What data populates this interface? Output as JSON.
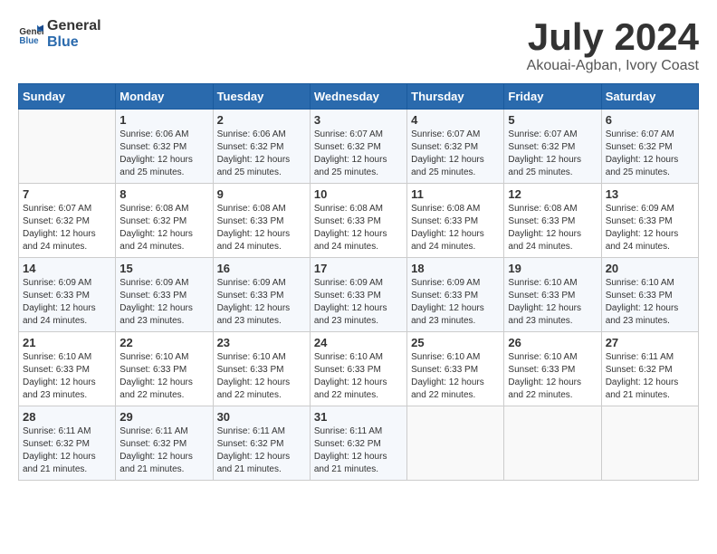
{
  "header": {
    "logo_general": "General",
    "logo_blue": "Blue",
    "month_year": "July 2024",
    "location": "Akouai-Agban, Ivory Coast"
  },
  "calendar": {
    "weekdays": [
      "Sunday",
      "Monday",
      "Tuesday",
      "Wednesday",
      "Thursday",
      "Friday",
      "Saturday"
    ],
    "weeks": [
      [
        {
          "day": "",
          "sunrise": "",
          "sunset": "",
          "daylight": "",
          "empty": true
        },
        {
          "day": "1",
          "sunrise": "Sunrise: 6:06 AM",
          "sunset": "Sunset: 6:32 PM",
          "daylight": "Daylight: 12 hours and 25 minutes."
        },
        {
          "day": "2",
          "sunrise": "Sunrise: 6:06 AM",
          "sunset": "Sunset: 6:32 PM",
          "daylight": "Daylight: 12 hours and 25 minutes."
        },
        {
          "day": "3",
          "sunrise": "Sunrise: 6:07 AM",
          "sunset": "Sunset: 6:32 PM",
          "daylight": "Daylight: 12 hours and 25 minutes."
        },
        {
          "day": "4",
          "sunrise": "Sunrise: 6:07 AM",
          "sunset": "Sunset: 6:32 PM",
          "daylight": "Daylight: 12 hours and 25 minutes."
        },
        {
          "day": "5",
          "sunrise": "Sunrise: 6:07 AM",
          "sunset": "Sunset: 6:32 PM",
          "daylight": "Daylight: 12 hours and 25 minutes."
        },
        {
          "day": "6",
          "sunrise": "Sunrise: 6:07 AM",
          "sunset": "Sunset: 6:32 PM",
          "daylight": "Daylight: 12 hours and 25 minutes."
        }
      ],
      [
        {
          "day": "7",
          "sunrise": "Sunrise: 6:07 AM",
          "sunset": "Sunset: 6:32 PM",
          "daylight": "Daylight: 12 hours and 24 minutes."
        },
        {
          "day": "8",
          "sunrise": "Sunrise: 6:08 AM",
          "sunset": "Sunset: 6:32 PM",
          "daylight": "Daylight: 12 hours and 24 minutes."
        },
        {
          "day": "9",
          "sunrise": "Sunrise: 6:08 AM",
          "sunset": "Sunset: 6:33 PM",
          "daylight": "Daylight: 12 hours and 24 minutes."
        },
        {
          "day": "10",
          "sunrise": "Sunrise: 6:08 AM",
          "sunset": "Sunset: 6:33 PM",
          "daylight": "Daylight: 12 hours and 24 minutes."
        },
        {
          "day": "11",
          "sunrise": "Sunrise: 6:08 AM",
          "sunset": "Sunset: 6:33 PM",
          "daylight": "Daylight: 12 hours and 24 minutes."
        },
        {
          "day": "12",
          "sunrise": "Sunrise: 6:08 AM",
          "sunset": "Sunset: 6:33 PM",
          "daylight": "Daylight: 12 hours and 24 minutes."
        },
        {
          "day": "13",
          "sunrise": "Sunrise: 6:09 AM",
          "sunset": "Sunset: 6:33 PM",
          "daylight": "Daylight: 12 hours and 24 minutes."
        }
      ],
      [
        {
          "day": "14",
          "sunrise": "Sunrise: 6:09 AM",
          "sunset": "Sunset: 6:33 PM",
          "daylight": "Daylight: 12 hours and 24 minutes."
        },
        {
          "day": "15",
          "sunrise": "Sunrise: 6:09 AM",
          "sunset": "Sunset: 6:33 PM",
          "daylight": "Daylight: 12 hours and 23 minutes."
        },
        {
          "day": "16",
          "sunrise": "Sunrise: 6:09 AM",
          "sunset": "Sunset: 6:33 PM",
          "daylight": "Daylight: 12 hours and 23 minutes."
        },
        {
          "day": "17",
          "sunrise": "Sunrise: 6:09 AM",
          "sunset": "Sunset: 6:33 PM",
          "daylight": "Daylight: 12 hours and 23 minutes."
        },
        {
          "day": "18",
          "sunrise": "Sunrise: 6:09 AM",
          "sunset": "Sunset: 6:33 PM",
          "daylight": "Daylight: 12 hours and 23 minutes."
        },
        {
          "day": "19",
          "sunrise": "Sunrise: 6:10 AM",
          "sunset": "Sunset: 6:33 PM",
          "daylight": "Daylight: 12 hours and 23 minutes."
        },
        {
          "day": "20",
          "sunrise": "Sunrise: 6:10 AM",
          "sunset": "Sunset: 6:33 PM",
          "daylight": "Daylight: 12 hours and 23 minutes."
        }
      ],
      [
        {
          "day": "21",
          "sunrise": "Sunrise: 6:10 AM",
          "sunset": "Sunset: 6:33 PM",
          "daylight": "Daylight: 12 hours and 23 minutes."
        },
        {
          "day": "22",
          "sunrise": "Sunrise: 6:10 AM",
          "sunset": "Sunset: 6:33 PM",
          "daylight": "Daylight: 12 hours and 22 minutes."
        },
        {
          "day": "23",
          "sunrise": "Sunrise: 6:10 AM",
          "sunset": "Sunset: 6:33 PM",
          "daylight": "Daylight: 12 hours and 22 minutes."
        },
        {
          "day": "24",
          "sunrise": "Sunrise: 6:10 AM",
          "sunset": "Sunset: 6:33 PM",
          "daylight": "Daylight: 12 hours and 22 minutes."
        },
        {
          "day": "25",
          "sunrise": "Sunrise: 6:10 AM",
          "sunset": "Sunset: 6:33 PM",
          "daylight": "Daylight: 12 hours and 22 minutes."
        },
        {
          "day": "26",
          "sunrise": "Sunrise: 6:10 AM",
          "sunset": "Sunset: 6:33 PM",
          "daylight": "Daylight: 12 hours and 22 minutes."
        },
        {
          "day": "27",
          "sunrise": "Sunrise: 6:11 AM",
          "sunset": "Sunset: 6:32 PM",
          "daylight": "Daylight: 12 hours and 21 minutes."
        }
      ],
      [
        {
          "day": "28",
          "sunrise": "Sunrise: 6:11 AM",
          "sunset": "Sunset: 6:32 PM",
          "daylight": "Daylight: 12 hours and 21 minutes."
        },
        {
          "day": "29",
          "sunrise": "Sunrise: 6:11 AM",
          "sunset": "Sunset: 6:32 PM",
          "daylight": "Daylight: 12 hours and 21 minutes."
        },
        {
          "day": "30",
          "sunrise": "Sunrise: 6:11 AM",
          "sunset": "Sunset: 6:32 PM",
          "daylight": "Daylight: 12 hours and 21 minutes."
        },
        {
          "day": "31",
          "sunrise": "Sunrise: 6:11 AM",
          "sunset": "Sunset: 6:32 PM",
          "daylight": "Daylight: 12 hours and 21 minutes."
        },
        {
          "day": "",
          "sunrise": "",
          "sunset": "",
          "daylight": "",
          "empty": true
        },
        {
          "day": "",
          "sunrise": "",
          "sunset": "",
          "daylight": "",
          "empty": true
        },
        {
          "day": "",
          "sunrise": "",
          "sunset": "",
          "daylight": "",
          "empty": true
        }
      ]
    ]
  }
}
